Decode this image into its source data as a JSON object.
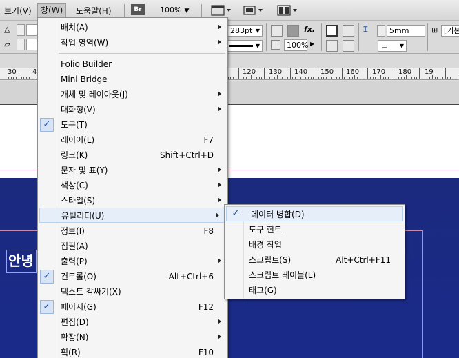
{
  "menubar": {
    "items": [
      {
        "label": "보기(V)"
      },
      {
        "label": "창(W)"
      },
      {
        "label": "도움말(H)"
      }
    ],
    "bridge_badge": "Br",
    "zoom": "100%"
  },
  "control": {
    "font_size": "283pt",
    "scale": "100%",
    "width_value": "5mm",
    "style_name": "[기본"
  },
  "ruler": {
    "labels": [
      "30",
      "4",
      "120",
      "130",
      "140",
      "150",
      "160",
      "170",
      "180",
      "19"
    ]
  },
  "document": {
    "text_frame": "안녕"
  },
  "window_menu": {
    "items": [
      {
        "label": "배치(A)",
        "submenu": true
      },
      {
        "label": "작업 영역(W)",
        "submenu": true
      },
      {
        "label": "Folio Builder"
      },
      {
        "label": "Mini Bridge"
      },
      {
        "label": "개체 및 레이아웃(J)",
        "submenu": true
      },
      {
        "label": "대화형(V)",
        "submenu": true
      },
      {
        "label": "도구(T)",
        "checked": true
      },
      {
        "label": "레이어(L)",
        "shortcut": "F7"
      },
      {
        "label": "링크(K)",
        "shortcut": "Shift+Ctrl+D"
      },
      {
        "label": "문자 및 표(Y)",
        "submenu": true
      },
      {
        "label": "색상(C)",
        "submenu": true
      },
      {
        "label": "스타일(S)",
        "submenu": true
      },
      {
        "label": "유틸리티(U)",
        "submenu": true,
        "highlighted": true
      },
      {
        "label": "정보(I)",
        "shortcut": "F8"
      },
      {
        "label": "집필(A)"
      },
      {
        "label": "출력(P)",
        "submenu": true
      },
      {
        "label": "컨트롤(O)",
        "shortcut": "Alt+Ctrl+6",
        "checked": true
      },
      {
        "label": "텍스트 감싸기(X)"
      },
      {
        "label": "페이지(G)",
        "shortcut": "F12",
        "checked": true
      },
      {
        "label": "편집(D)",
        "submenu": true
      },
      {
        "label": "확장(N)",
        "submenu": true
      },
      {
        "label": "획(R)",
        "shortcut": "F10"
      }
    ]
  },
  "utilities_submenu": {
    "items": [
      {
        "label": "데이터 병합(D)",
        "checked": true,
        "highlighted": true
      },
      {
        "label": "도구 힌트"
      },
      {
        "label": "배경 작업"
      },
      {
        "label": "스크립트(S)",
        "shortcut": "Alt+Ctrl+F11"
      },
      {
        "label": "스크립트 레이블(L)"
      },
      {
        "label": "태그(G)"
      }
    ]
  },
  "colors": {
    "accent_check": "#1a4fa0",
    "highlight": "#e5eef9",
    "page_blue": "#1b2a7e"
  }
}
